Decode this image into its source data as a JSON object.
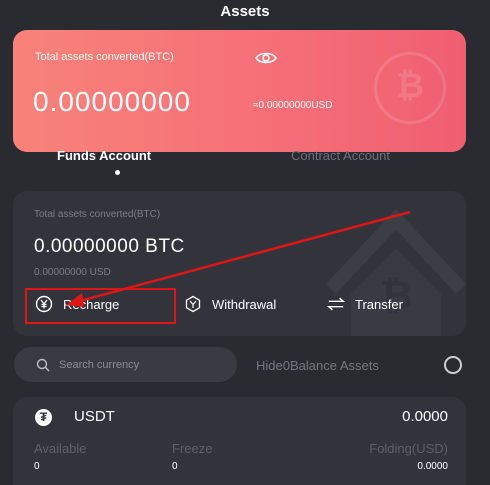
{
  "header": {
    "title": "Assets"
  },
  "total_card": {
    "label": "Total assets converted(BTC)",
    "value": "0.00000000",
    "usd": "≈0.00000000USD",
    "watermark": "₿"
  },
  "tabs": [
    {
      "label": "Funds Account",
      "active": true
    },
    {
      "label": "Contract Account",
      "active": false
    }
  ],
  "funds_card": {
    "label": "Total assets converted(BTC)",
    "value": "0.00000000 BTC",
    "usd": "0.00000000 USD",
    "actions": {
      "recharge": "Recharge",
      "withdrawal": "Withdrawal",
      "transfer": "Transfer"
    }
  },
  "search": {
    "placeholder": "Search currency"
  },
  "hide_zero": {
    "label": "Hide0Balance Assets"
  },
  "asset": {
    "coin": "USDT",
    "coin_symbol": "₮",
    "amount": "0.0000",
    "headers": {
      "available": "Available",
      "freeze": "Freeze",
      "folding": "Folding(USD)"
    },
    "values": {
      "available": "0",
      "freeze": "0",
      "folding": "0.0000"
    }
  },
  "colors": {
    "background": "#2a2a31",
    "card_gradient_start": "#f8837a",
    "card_gradient_end": "#ef5f72",
    "annotation_red": "#e01515"
  },
  "icons": [
    "eye-icon",
    "bitcoin-watermark-icon",
    "house-watermark-icon",
    "recharge-icon",
    "withdrawal-icon",
    "transfer-icon",
    "search-icon",
    "tether-icon"
  ]
}
